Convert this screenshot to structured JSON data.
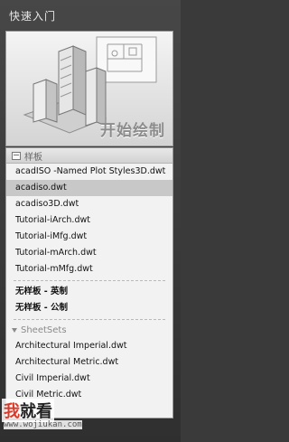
{
  "panel_title": "快速入门",
  "hero": {
    "label": "开始绘制"
  },
  "templates": {
    "header": "样板",
    "items": [
      "acadISO -Named Plot Styles3D.dwt",
      "acadiso.dwt",
      "acadiso3D.dwt",
      "Tutorial-iArch.dwt",
      "Tutorial-iMfg.dwt",
      "Tutorial-mArch.dwt",
      "Tutorial-mMfg.dwt"
    ],
    "selected_index": 1,
    "no_template": [
      "无样板 - 英制",
      "无样板 - 公制"
    ]
  },
  "sheetsets": {
    "header": "SheetSets",
    "items": [
      "Architectural Imperial.dwt",
      "Architectural Metric.dwt",
      "Civil Imperial.dwt",
      "Civil Metric.dwt"
    ]
  },
  "watermark": {
    "text_accent": "我",
    "text_rest": "就看",
    "url": "www.wojiukan.com"
  }
}
